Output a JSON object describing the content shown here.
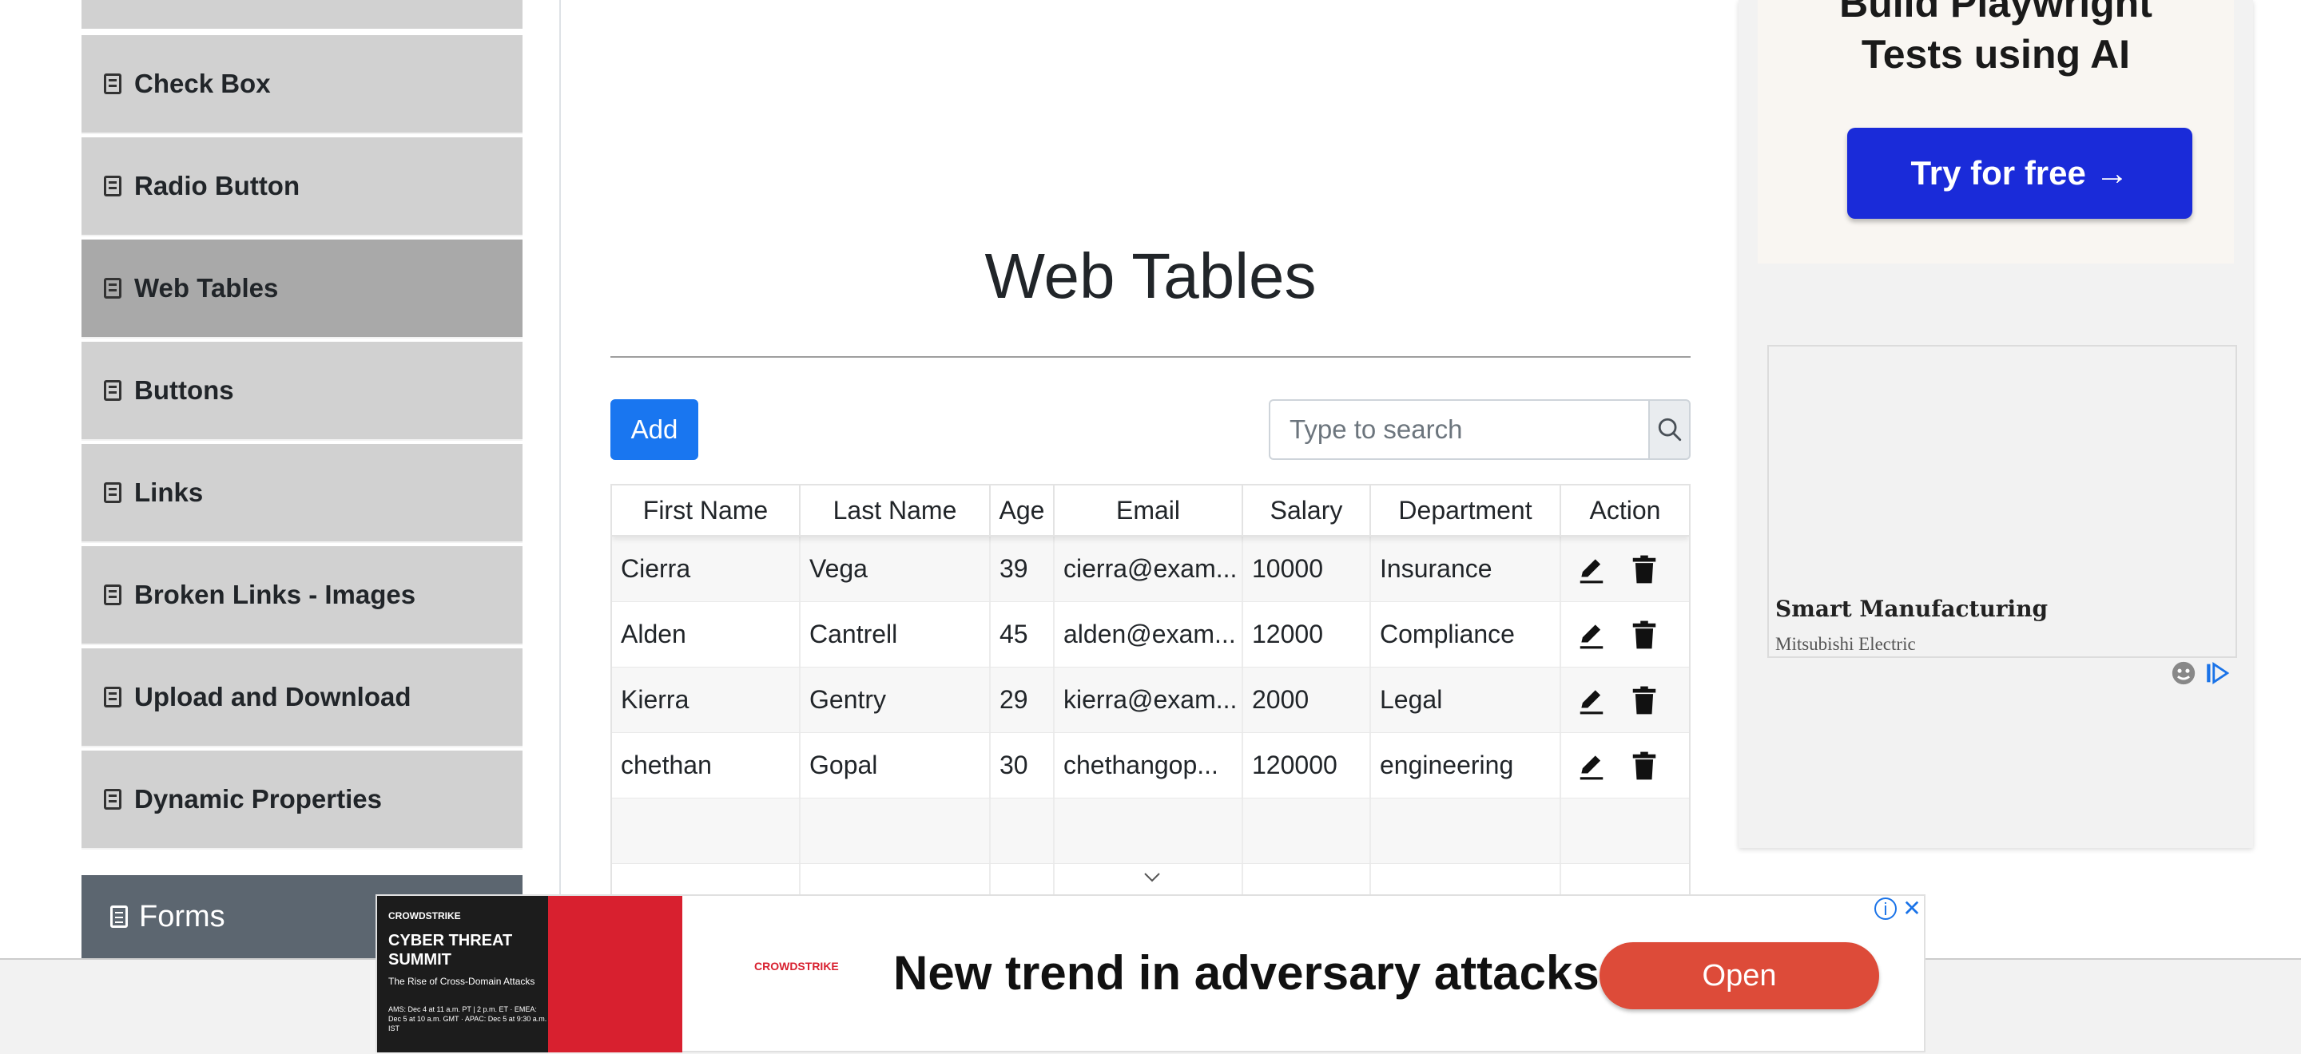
{
  "sidebar": {
    "items": [
      {
        "label": "Check Box"
      },
      {
        "label": "Radio Button"
      },
      {
        "label": "Web Tables"
      },
      {
        "label": "Buttons"
      },
      {
        "label": "Links"
      },
      {
        "label": "Broken Links - Images"
      },
      {
        "label": "Upload and Download"
      },
      {
        "label": "Dynamic Properties"
      }
    ],
    "active_item": "Web Tables",
    "group": {
      "label": "Forms"
    }
  },
  "main": {
    "title": "Web Tables",
    "add_label": "Add",
    "search": {
      "placeholder": "Type to search",
      "value": ""
    },
    "table": {
      "headers": [
        "First Name",
        "Last Name",
        "Age",
        "Email",
        "Salary",
        "Department",
        "Action"
      ],
      "rows": [
        [
          "Cierra",
          "Vega",
          "39",
          "cierra@exam...",
          "10000",
          "Insurance"
        ],
        [
          "Alden",
          "Cantrell",
          "45",
          "alden@exam...",
          "12000",
          "Compliance"
        ],
        [
          "Kierra",
          "Gentry",
          "29",
          "kierra@exam...",
          "2000",
          "Legal"
        ],
        [
          "chethan",
          "Gopal",
          "30",
          "chethangop...",
          "120000",
          "engineering"
        ]
      ]
    }
  },
  "right_ad": {
    "headline_line1": "Build Playwright",
    "headline_line2": "Tests using AI",
    "cta": "Try for free →",
    "card_title": "Smart Manufacturing",
    "card_sub": "Mitsubishi Electric"
  },
  "bottom_ad": {
    "brand": "CROWDSTRIKE",
    "image_headline": "CYBER THREAT SUMMIT",
    "image_sub": "The Rise of Cross-Domain Attacks",
    "image_dates": "AMS: Dec 4 at 11 a.m. PT | 2 p.m. ET · EMEA: Dec 5 at 10 a.m. GMT · APAC: Dec 5 at 9:30 a.m. IST",
    "logo": "CROWDSTRIKE",
    "text": "New trend in adversary attacks",
    "cta": "Open"
  },
  "colors": {
    "primary": "#1976f0",
    "sidebar_item": "#d1d1d1",
    "sidebar_active": "#a9a9a9",
    "group_header": "#5c6670",
    "cta_blue": "#1a2bd9",
    "ad_open": "#dd4b39"
  },
  "icons": {
    "sidebar_item_icon": "html5-icon",
    "search": "search-icon",
    "edit": "pencil-icon",
    "delete": "trash-icon"
  }
}
